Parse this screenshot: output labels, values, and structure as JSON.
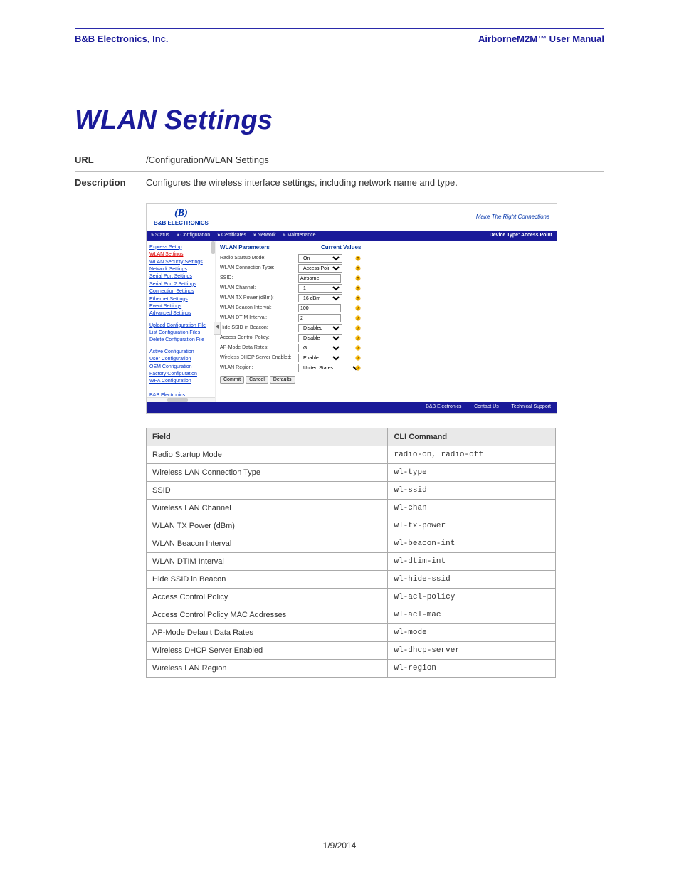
{
  "header": {
    "left": "B&B Electronics, Inc.",
    "right": "AirborneM2M™ User Manual"
  },
  "title": "WLAN Settings",
  "meta": {
    "url_label": "URL",
    "url_value": "/Configuration/WLAN Settings",
    "desc_label": "Description",
    "desc_value": "Configures the wireless interface settings, including network name and type."
  },
  "embed": {
    "logo_line1": "(B)",
    "logo_line2": "B&B ELECTRONICS",
    "tagline": "Make The Right Connections",
    "nav": {
      "items": [
        "Status",
        "Configuration",
        "Certificates",
        "Network",
        "Maintenance"
      ],
      "device_type": "Device Type: Access Point"
    },
    "sidebar": {
      "group1": [
        {
          "label": "Express Setup",
          "active": false
        },
        {
          "label": "WLAN Settings",
          "active": true
        },
        {
          "label": "WLAN Security Settings",
          "active": false
        },
        {
          "label": "Network Settings",
          "active": false
        },
        {
          "label": "Serial Port Settings",
          "active": false
        },
        {
          "label": "Serial Port 2 Settings",
          "active": false
        },
        {
          "label": "Connection Settings",
          "active": false
        },
        {
          "label": "Ethernet Settings",
          "active": false
        },
        {
          "label": "Event Settings",
          "active": false
        },
        {
          "label": "Advanced Settings",
          "active": false
        }
      ],
      "group2": [
        {
          "label": "Upload Configuration File"
        },
        {
          "label": "List Configuration Files"
        },
        {
          "label": "Delete Configuration File"
        }
      ],
      "group3": [
        {
          "label": "Active Configuration"
        },
        {
          "label": "User Configuration"
        },
        {
          "label": "OEM Configuration"
        },
        {
          "label": "Factory Configuration"
        },
        {
          "label": "WPA Configuration"
        }
      ],
      "footer_link": "B&B Electronics"
    },
    "main": {
      "section_title": "WLAN Parameters",
      "current_values_label": "Current Values",
      "rows": [
        {
          "label": "Radio Startup Mode:",
          "type": "select",
          "value": "On"
        },
        {
          "label": "WLAN Connection Type:",
          "type": "select",
          "value": "Access Point"
        },
        {
          "label": "SSID:",
          "type": "text",
          "value": "Airborne"
        },
        {
          "label": "WLAN Channel:",
          "type": "select",
          "value": "1"
        },
        {
          "label": "WLAN TX Power (dBm):",
          "type": "select",
          "value": "16 dBm"
        },
        {
          "label": "WLAN Beacon Interval:",
          "type": "text",
          "value": "100"
        },
        {
          "label": "WLAN DTIM Interval:",
          "type": "text",
          "value": "2"
        },
        {
          "label": "Hide SSID in Beacon:",
          "type": "select",
          "value": "Disabled"
        },
        {
          "label": "Access Control Policy:",
          "type": "select",
          "value": "Disable"
        },
        {
          "label": "AP-Mode Data Rates:",
          "type": "select",
          "value": "G"
        },
        {
          "label": "Wireless DHCP Server Enabled:",
          "type": "select",
          "value": "Enable"
        },
        {
          "label": "WLAN Region:",
          "type": "select-wide",
          "value": "United States"
        }
      ],
      "buttons": [
        "Commit",
        "Cancel",
        "Defaults"
      ]
    },
    "footer": {
      "links": [
        "B&B Electronics",
        "Contact Us",
        "Technical Support"
      ]
    }
  },
  "cli_table": {
    "headers": [
      "Field",
      "CLI Command"
    ],
    "rows": [
      [
        "Radio Startup Mode",
        "radio-on, radio-off"
      ],
      [
        "Wireless LAN Connection Type",
        "wl-type"
      ],
      [
        "SSID",
        "wl-ssid"
      ],
      [
        "Wireless LAN Channel",
        "wl-chan"
      ],
      [
        "WLAN TX Power (dBm)",
        "wl-tx-power"
      ],
      [
        "WLAN Beacon Interval",
        "wl-beacon-int"
      ],
      [
        "WLAN DTIM Interval",
        "wl-dtim-int"
      ],
      [
        "Hide SSID in Beacon",
        "wl-hide-ssid"
      ],
      [
        "Access Control Policy",
        "wl-acl-policy"
      ],
      [
        "Access Control Policy MAC Addresses",
        "wl-acl-mac"
      ],
      [
        "AP-Mode Default Data Rates",
        "wl-mode"
      ],
      [
        "Wireless DHCP Server Enabled",
        "wl-dhcp-server"
      ],
      [
        "Wireless LAN Region",
        "wl-region"
      ]
    ]
  },
  "page_date": "1/9/2014"
}
